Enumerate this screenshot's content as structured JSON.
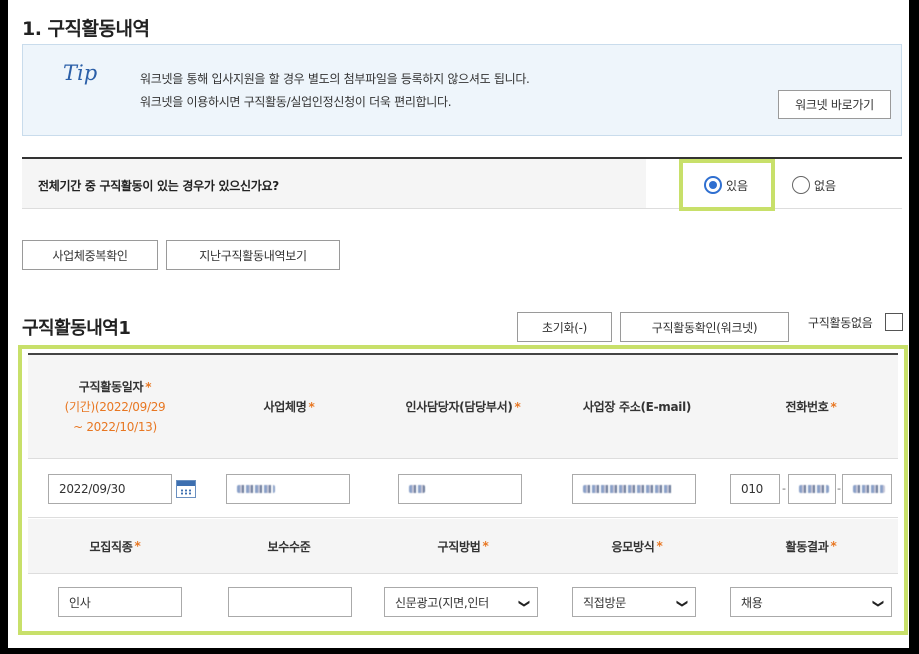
{
  "section": {
    "title": "1. 구직활동내역"
  },
  "tip": {
    "label": "Tip",
    "line1": "워크넷을 통해 입사지원을 할 경우 별도의 첨부파일을 등록하지 않으셔도 됩니다.",
    "line2": "워크넷을 이용하시면 구직활동/실업인정신청이 더욱 편리합니다.",
    "button": "워크넷 바로가기"
  },
  "question": {
    "text": "전체기간 중 구직활동이 있는 경우가 있으신가요?",
    "yes": "있음",
    "no": "없음",
    "selected": "yes"
  },
  "actions": {
    "dup_check": "사업체중복확인",
    "past_view": "지난구직활동내역보기"
  },
  "activity": {
    "title": "구직활동내역1",
    "reset": "초기화(-)",
    "confirm": "구직활동확인(워크넷)",
    "none_label": "구직활동없음"
  },
  "grid": {
    "headers1": {
      "date": "구직활동일자",
      "date_range1": "(기간)(2022/09/29",
      "date_range2": "~ 2022/10/13)",
      "company": "사업체명",
      "manager": "인사담당자(담당부서)",
      "address": "사업장 주소(E-mail)",
      "phone": "전화번호"
    },
    "row1": {
      "date": "2022/09/30",
      "phone_prefix": "010",
      "phone_dash1": "-",
      "phone_dash2": "-"
    },
    "headers2": {
      "job": "모집직종",
      "salary": "보수수준",
      "method": "구직방법",
      "apply": "응모방식",
      "result": "활동결과"
    },
    "row2": {
      "job": "인사",
      "salary": "",
      "method": "신문광고(지면,인터",
      "apply": "직접방문",
      "result": "채용"
    }
  },
  "required_mark": "*",
  "colors": {
    "accent": "#2f6fd0",
    "highlight": "#c8e06a",
    "required": "#e87722"
  }
}
